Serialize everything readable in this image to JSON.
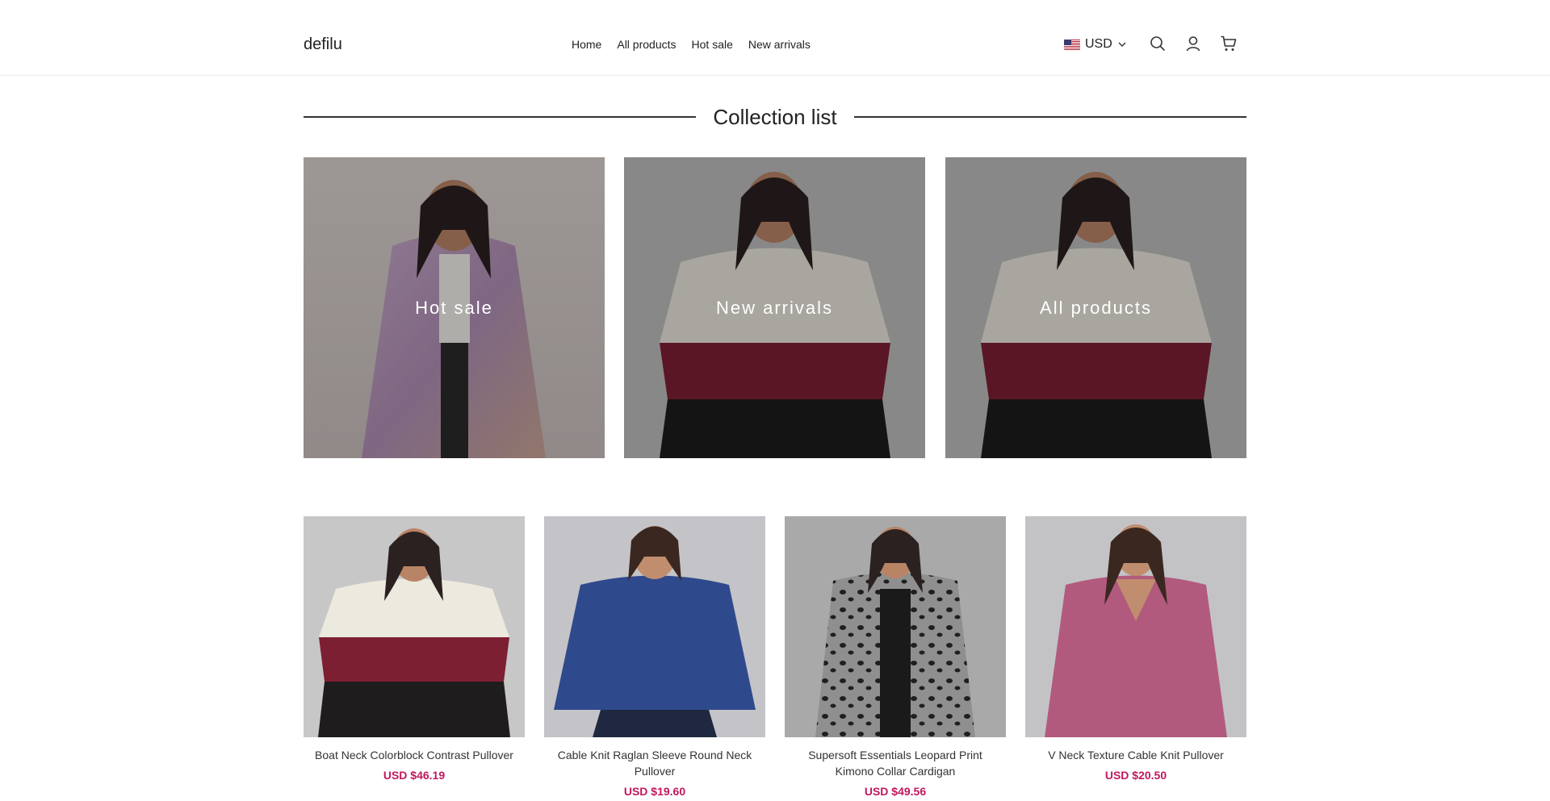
{
  "header": {
    "logo": "defilu",
    "nav": [
      "Home",
      "All products",
      "Hot sale",
      "New arrivals"
    ],
    "currency": "USD",
    "icons": [
      "us-flag-icon",
      "chevron-down-icon",
      "search-icon",
      "account-icon",
      "cart-icon"
    ]
  },
  "collection_section": {
    "title": "Collection list",
    "items": [
      {
        "label": "Hot sale",
        "image": "woman in gradient knit cardigan"
      },
      {
        "label": "New arrivals",
        "image": "woman in colorblock pullover"
      },
      {
        "label": "All products",
        "image": "woman in colorblock pullover"
      }
    ]
  },
  "products": [
    {
      "name": "Boat Neck Colorblock Contrast Pullover",
      "price": "USD $46.19"
    },
    {
      "name": "Cable Knit Raglan Sleeve Round Neck Pullover",
      "price": "USD $19.60"
    },
    {
      "name": "Supersoft Essentials Leopard Print Kimono Collar Cardigan",
      "price": "USD $49.56"
    },
    {
      "name": "V Neck Texture Cable Knit Pullover",
      "price": "USD $20.50"
    }
  ],
  "colors": {
    "price": "#c1185b",
    "text": "#222222",
    "divider": "#333333"
  }
}
